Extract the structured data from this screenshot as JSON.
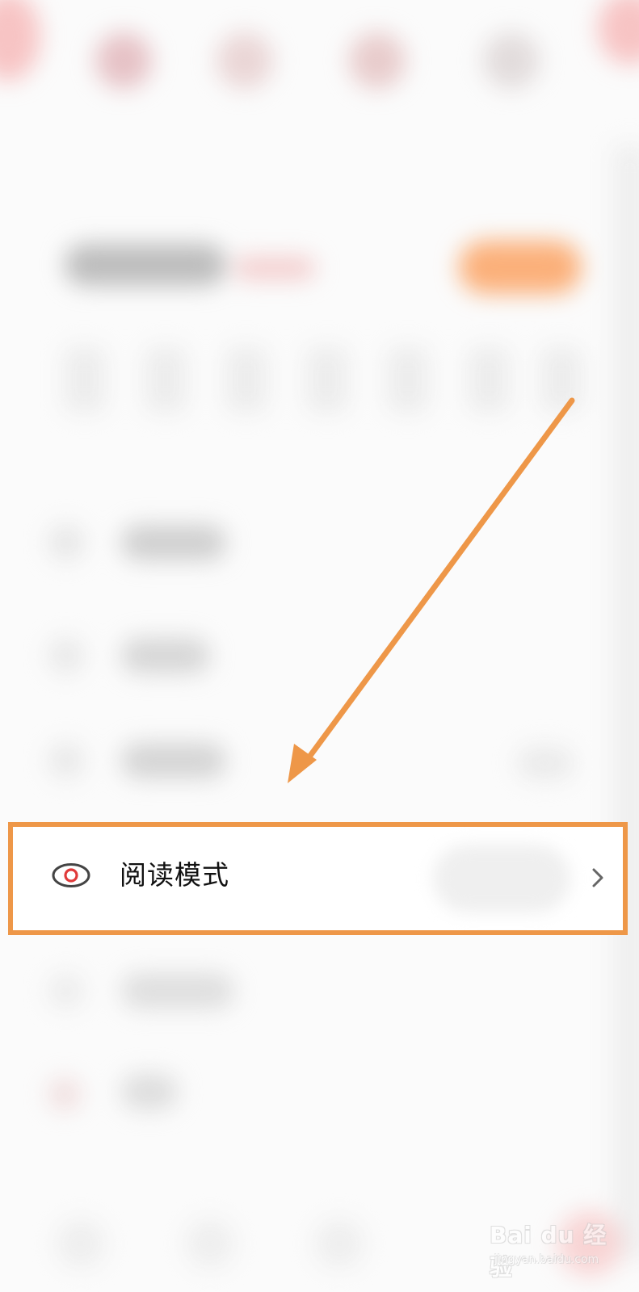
{
  "highlighted_row": {
    "label": "阅读模式",
    "icon": "eye-icon",
    "trailing_icon": "chevron-right-icon"
  },
  "watermark": {
    "main": "Bai du 经验",
    "sub": "jingyan.baidu.com"
  },
  "colors": {
    "annotation_orange": "#ee9748",
    "eye_icon_stroke": "#444444",
    "eye_icon_pupil": "#e03a3a",
    "chevron": "#666666"
  }
}
